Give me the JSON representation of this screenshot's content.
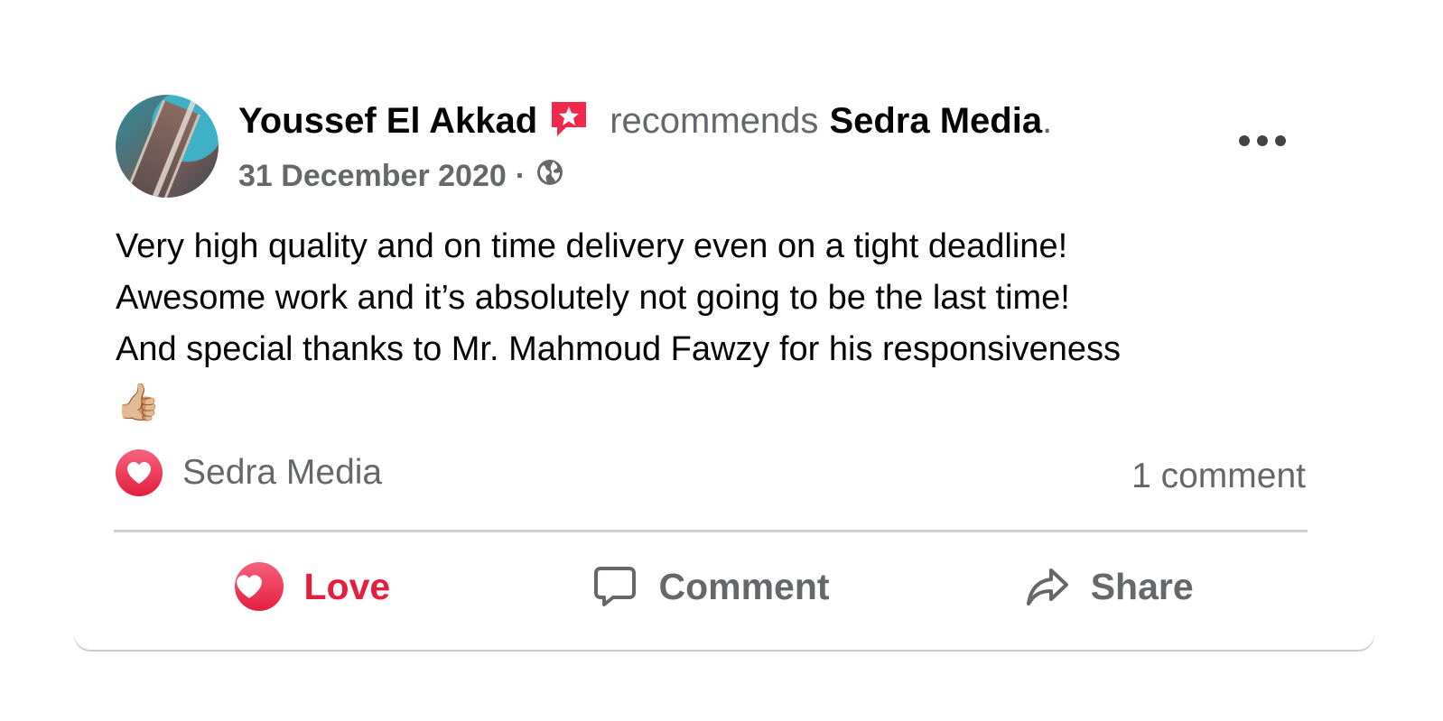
{
  "post": {
    "author": "Youssef El Akkad",
    "verb": "recommends",
    "page": "Sedra Media",
    "period": ".",
    "date": "31 December 2020",
    "separator": "·",
    "audience_icon": "globe-icon",
    "recommend_icon": "recommendation-star-icon",
    "body": {
      "line1": "Very high quality and on time delivery even on a tight deadline!",
      "line2": "Awesome work and it’s absolutely not going to be the last time!",
      "line3": "And special thanks to Mr. Mahmoud Fawzy for his responsiveness",
      "emoji": "👍🏼"
    }
  },
  "reactions": {
    "icon": "love-reaction-icon",
    "label": "Sedra Media",
    "comments": "1 comment"
  },
  "actions": {
    "love": "Love",
    "comment": "Comment",
    "share": "Share"
  },
  "colors": {
    "love": "#e41e3f",
    "secondary_text": "#65676b",
    "primary_text": "#050505",
    "divider": "#ced0d4",
    "recommend_badge": "#f02849"
  }
}
